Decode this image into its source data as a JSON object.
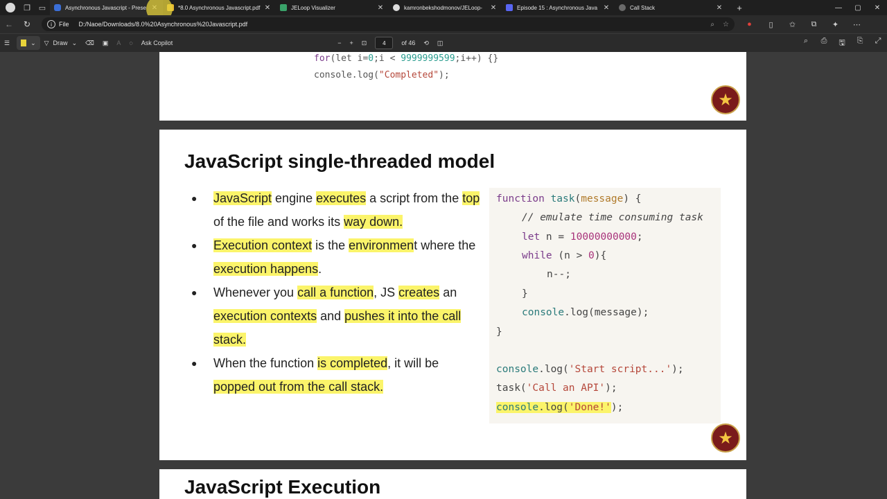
{
  "browser": {
    "tabs": [
      {
        "label": "Asynchronous Javascript - Prese",
        "color": "#3b6fd8",
        "active": true
      },
      {
        "label": "*8.0 Asynchronous Javascript.pdf",
        "color": "#e8b930",
        "active": false
      },
      {
        "label": "JELoop Visualizer",
        "color": "#3aa36a",
        "active": false
      },
      {
        "label": "kamronbekshodmonov/JELoop-",
        "color": "#dddddd",
        "active": false
      },
      {
        "label": "Episode 15 : Asynchronous Java",
        "color": "#5865f2",
        "active": false
      },
      {
        "label": "Call Stack",
        "color": "#6a6a6a",
        "active": false
      }
    ],
    "address": {
      "prefix": "File",
      "url": "D:/Naoe/Downloads/8.0%20Asynchronous%20Javascript.pdf"
    }
  },
  "pdf_toolbar": {
    "draw_label": "Draw",
    "copilot_label": "Ask Copilot",
    "page_current": "4",
    "page_total": "of 46"
  },
  "page1": {
    "line1": {
      "kw": "for",
      "a": "(let i=",
      "n0": "0",
      "b": ";i < ",
      "n1": "9999999599",
      "c": ";i++) {}"
    },
    "line2": {
      "a": "console.log(",
      "s": "\"Completed\"",
      "b": ");"
    }
  },
  "page2": {
    "title": "JavaScript single-threaded model",
    "bullets": {
      "b1": {
        "h1": "JavaScript",
        "t1": " engine ",
        "h2": "executes",
        "t2": " a script from the ",
        "h3": "top",
        "t3": " of the file and works its ",
        "h4": "way down."
      },
      "b2": {
        "h1": "Execution context",
        "t1": " is the ",
        "h2": "environmen",
        "t2": "t where the ",
        "h3": "execution happens",
        "t3": "."
      },
      "b3": {
        "t0": "Whenever you ",
        "h1": "call a function",
        "t1": ", JS ",
        "h2": "creates",
        "t2": " an ",
        "h3": "execution contexts",
        "t3": " and ",
        "h4": "pushes it into the call stack."
      },
      "b4": {
        "t0": "When the function ",
        "h1": "is completed",
        "t1": ", it will be ",
        "h2": "popped out from the call stack."
      }
    },
    "code": {
      "l1": {
        "kw": "function ",
        "fn": "task",
        "p0": "(",
        "param": "message",
        "p1": ") {"
      },
      "l2": "// emulate time consuming task",
      "l3": {
        "kw": "let",
        "a": " n = ",
        "num": "10000000000",
        "b": ";"
      },
      "l4": {
        "kw": "while",
        "a": " (n > ",
        "num": "0",
        "b": "){"
      },
      "l5": "n--;",
      "l6": "}",
      "l7": {
        "fn": "console",
        "a": ".log(message);"
      },
      "l8": "}",
      "l9": {
        "fn": "console",
        "a": ".log(",
        "s": "'Start script...'",
        "b": ");"
      },
      "l10": {
        "a": "task(",
        "s": "'Call an API'",
        "b": ");"
      },
      "l11": {
        "fn": "console",
        "a": ".log(",
        "s": "'Done!'",
        "b": ");"
      }
    }
  },
  "page3": {
    "title": "JavaScript Execution"
  }
}
